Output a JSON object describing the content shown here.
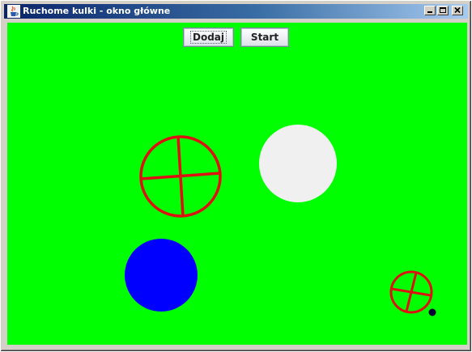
{
  "window": {
    "title": "Ruchome kulki - okno główne",
    "icon": "java-cup-icon",
    "controls": [
      "minimize-icon",
      "maximize-icon",
      "close-icon"
    ]
  },
  "toolbar": {
    "add_label": "Dodaj",
    "start_label": "Start"
  },
  "canvas": {
    "background": "#00ff00",
    "balls": [
      {
        "kind": "crosshair-ball",
        "color": "#dd1111"
      },
      {
        "kind": "solid-ball",
        "color": "#f0f0f0"
      },
      {
        "kind": "solid-ball",
        "color": "#0000ff"
      },
      {
        "kind": "crosshair-ball",
        "color": "#dd1111"
      },
      {
        "kind": "solid-ball",
        "color": "#000033"
      }
    ]
  }
}
